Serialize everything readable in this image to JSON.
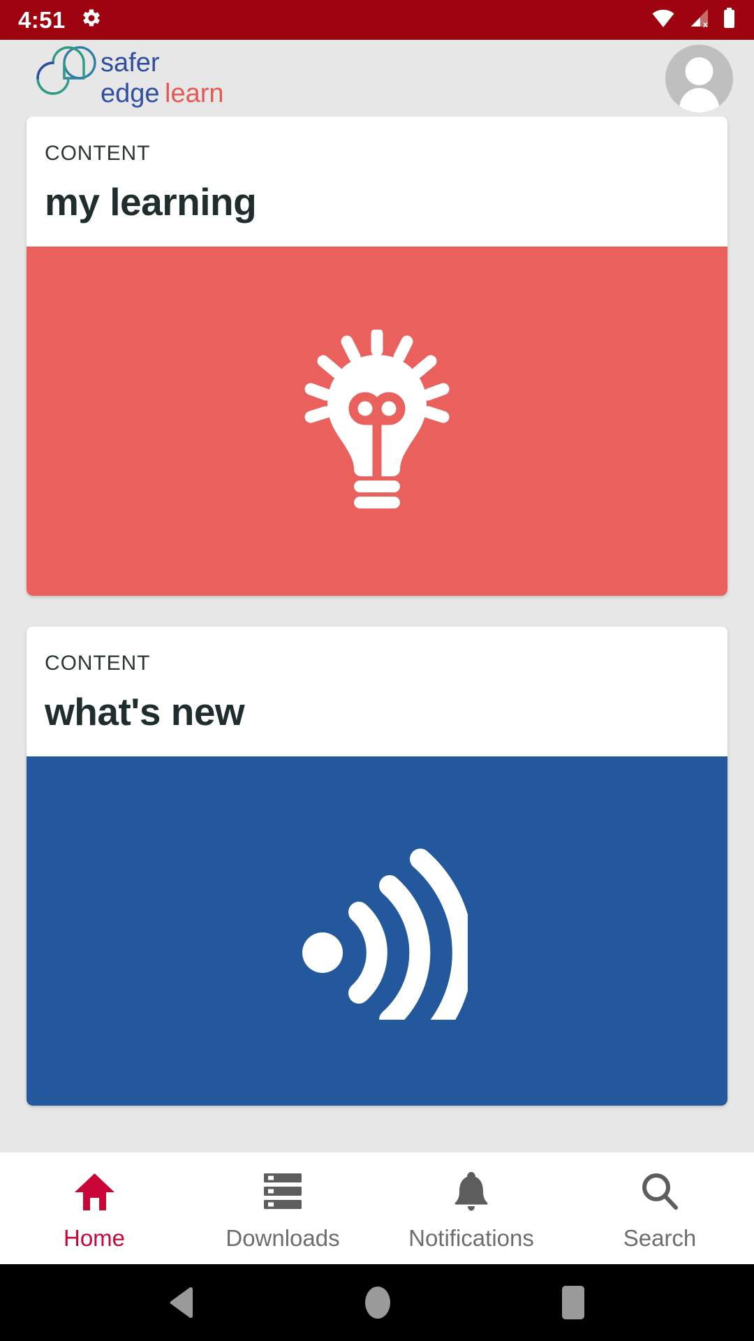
{
  "status_bar": {
    "time": "4:51",
    "icons": [
      "gear-icon",
      "wifi-icon",
      "cell-signal-no-sim-icon",
      "battery-icon"
    ],
    "background": "#9e0310"
  },
  "header": {
    "logo": {
      "line1": "safer",
      "line2_part1": "edge",
      "line2_part2": "learn",
      "color_blue": "#2e4f9e",
      "color_red": "#e45a52",
      "color_teal": "#2f9b85"
    },
    "avatar": "user-avatar",
    "background": "#e7e7e7"
  },
  "cards": [
    {
      "kicker": "CONTENT",
      "title": "my learning",
      "banner_color": "#e9605c",
      "banner_icon": "lightbulb-icon"
    },
    {
      "kicker": "CONTENT",
      "title": "what's new",
      "banner_color": "#23589d",
      "banner_icon": "broadcast-rss-icon"
    }
  ],
  "bottom_nav": {
    "active_color": "#ca0538",
    "inactive_color": "#6d6d6d",
    "items": [
      {
        "label": "Home",
        "icon": "home-icon",
        "active": true
      },
      {
        "label": "Downloads",
        "icon": "storage-list-icon",
        "active": false
      },
      {
        "label": "Notifications",
        "icon": "bell-icon",
        "active": false
      },
      {
        "label": "Search",
        "icon": "search-icon",
        "active": false
      }
    ]
  },
  "system_nav": {
    "back": "back-triangle-icon",
    "home": "home-circle-icon",
    "recents": "recents-square-icon"
  }
}
